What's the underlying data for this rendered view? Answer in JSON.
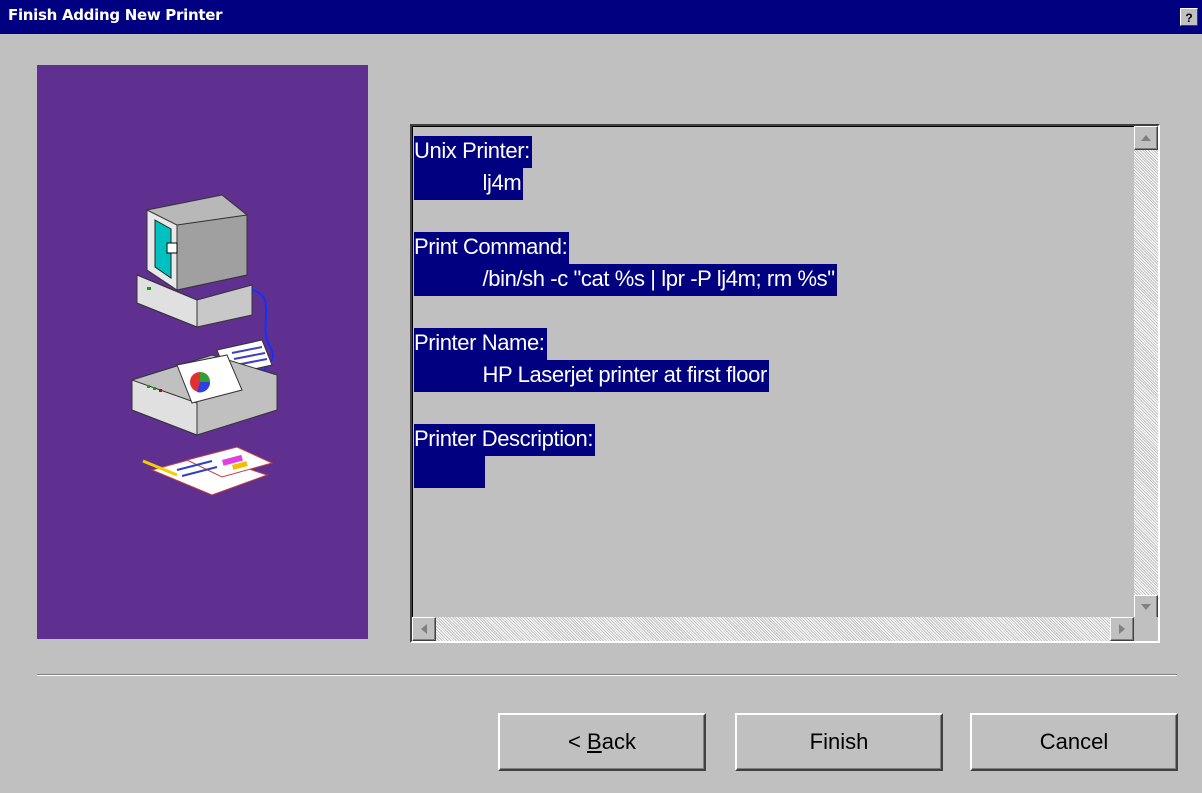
{
  "window": {
    "title": "Finish Adding New Printer",
    "help_label": "?"
  },
  "summary": {
    "lines": [
      "Unix Printer:",
      "            lj4m",
      "Print Command:",
      "            /bin/sh -c \"cat %s | lpr -P lj4m; rm %s\"",
      "Printer Name:",
      "            HP Laserjet printer at first floor",
      "Printer Description:",
      "            "
    ]
  },
  "buttons": {
    "back_prefix": "< ",
    "back_accel": "B",
    "back_rest": "ack",
    "finish": "Finish",
    "cancel": "Cancel"
  },
  "colors": {
    "titlebar": "#000080",
    "side_panel": "#603090",
    "selection": "#000080",
    "dialog_bg": "#c0c0c0"
  }
}
